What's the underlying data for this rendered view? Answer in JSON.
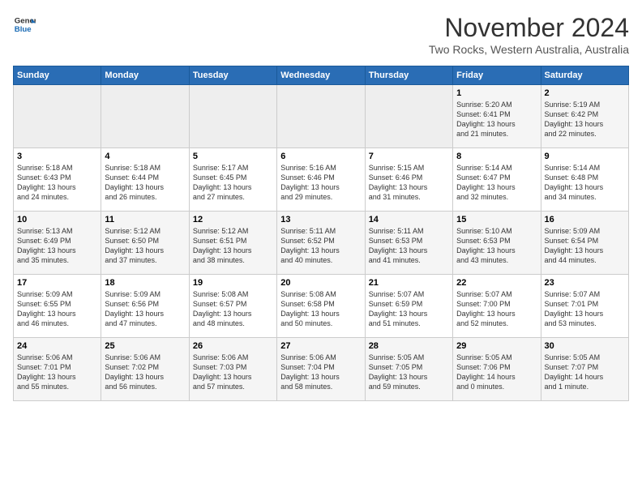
{
  "header": {
    "logo_line1": "General",
    "logo_line2": "Blue",
    "title": "November 2024",
    "subtitle": "Two Rocks, Western Australia, Australia"
  },
  "columns": [
    "Sunday",
    "Monday",
    "Tuesday",
    "Wednesday",
    "Thursday",
    "Friday",
    "Saturday"
  ],
  "weeks": [
    [
      {
        "day": "",
        "info": ""
      },
      {
        "day": "",
        "info": ""
      },
      {
        "day": "",
        "info": ""
      },
      {
        "day": "",
        "info": ""
      },
      {
        "day": "",
        "info": ""
      },
      {
        "day": "1",
        "info": "Sunrise: 5:20 AM\nSunset: 6:41 PM\nDaylight: 13 hours\nand 21 minutes."
      },
      {
        "day": "2",
        "info": "Sunrise: 5:19 AM\nSunset: 6:42 PM\nDaylight: 13 hours\nand 22 minutes."
      }
    ],
    [
      {
        "day": "3",
        "info": "Sunrise: 5:18 AM\nSunset: 6:43 PM\nDaylight: 13 hours\nand 24 minutes."
      },
      {
        "day": "4",
        "info": "Sunrise: 5:18 AM\nSunset: 6:44 PM\nDaylight: 13 hours\nand 26 minutes."
      },
      {
        "day": "5",
        "info": "Sunrise: 5:17 AM\nSunset: 6:45 PM\nDaylight: 13 hours\nand 27 minutes."
      },
      {
        "day": "6",
        "info": "Sunrise: 5:16 AM\nSunset: 6:46 PM\nDaylight: 13 hours\nand 29 minutes."
      },
      {
        "day": "7",
        "info": "Sunrise: 5:15 AM\nSunset: 6:46 PM\nDaylight: 13 hours\nand 31 minutes."
      },
      {
        "day": "8",
        "info": "Sunrise: 5:14 AM\nSunset: 6:47 PM\nDaylight: 13 hours\nand 32 minutes."
      },
      {
        "day": "9",
        "info": "Sunrise: 5:14 AM\nSunset: 6:48 PM\nDaylight: 13 hours\nand 34 minutes."
      }
    ],
    [
      {
        "day": "10",
        "info": "Sunrise: 5:13 AM\nSunset: 6:49 PM\nDaylight: 13 hours\nand 35 minutes."
      },
      {
        "day": "11",
        "info": "Sunrise: 5:12 AM\nSunset: 6:50 PM\nDaylight: 13 hours\nand 37 minutes."
      },
      {
        "day": "12",
        "info": "Sunrise: 5:12 AM\nSunset: 6:51 PM\nDaylight: 13 hours\nand 38 minutes."
      },
      {
        "day": "13",
        "info": "Sunrise: 5:11 AM\nSunset: 6:52 PM\nDaylight: 13 hours\nand 40 minutes."
      },
      {
        "day": "14",
        "info": "Sunrise: 5:11 AM\nSunset: 6:53 PM\nDaylight: 13 hours\nand 41 minutes."
      },
      {
        "day": "15",
        "info": "Sunrise: 5:10 AM\nSunset: 6:53 PM\nDaylight: 13 hours\nand 43 minutes."
      },
      {
        "day": "16",
        "info": "Sunrise: 5:09 AM\nSunset: 6:54 PM\nDaylight: 13 hours\nand 44 minutes."
      }
    ],
    [
      {
        "day": "17",
        "info": "Sunrise: 5:09 AM\nSunset: 6:55 PM\nDaylight: 13 hours\nand 46 minutes."
      },
      {
        "day": "18",
        "info": "Sunrise: 5:09 AM\nSunset: 6:56 PM\nDaylight: 13 hours\nand 47 minutes."
      },
      {
        "day": "19",
        "info": "Sunrise: 5:08 AM\nSunset: 6:57 PM\nDaylight: 13 hours\nand 48 minutes."
      },
      {
        "day": "20",
        "info": "Sunrise: 5:08 AM\nSunset: 6:58 PM\nDaylight: 13 hours\nand 50 minutes."
      },
      {
        "day": "21",
        "info": "Sunrise: 5:07 AM\nSunset: 6:59 PM\nDaylight: 13 hours\nand 51 minutes."
      },
      {
        "day": "22",
        "info": "Sunrise: 5:07 AM\nSunset: 7:00 PM\nDaylight: 13 hours\nand 52 minutes."
      },
      {
        "day": "23",
        "info": "Sunrise: 5:07 AM\nSunset: 7:01 PM\nDaylight: 13 hours\nand 53 minutes."
      }
    ],
    [
      {
        "day": "24",
        "info": "Sunrise: 5:06 AM\nSunset: 7:01 PM\nDaylight: 13 hours\nand 55 minutes."
      },
      {
        "day": "25",
        "info": "Sunrise: 5:06 AM\nSunset: 7:02 PM\nDaylight: 13 hours\nand 56 minutes."
      },
      {
        "day": "26",
        "info": "Sunrise: 5:06 AM\nSunset: 7:03 PM\nDaylight: 13 hours\nand 57 minutes."
      },
      {
        "day": "27",
        "info": "Sunrise: 5:06 AM\nSunset: 7:04 PM\nDaylight: 13 hours\nand 58 minutes."
      },
      {
        "day": "28",
        "info": "Sunrise: 5:05 AM\nSunset: 7:05 PM\nDaylight: 13 hours\nand 59 minutes."
      },
      {
        "day": "29",
        "info": "Sunrise: 5:05 AM\nSunset: 7:06 PM\nDaylight: 14 hours\nand 0 minutes."
      },
      {
        "day": "30",
        "info": "Sunrise: 5:05 AM\nSunset: 7:07 PM\nDaylight: 14 hours\nand 1 minute."
      }
    ]
  ]
}
